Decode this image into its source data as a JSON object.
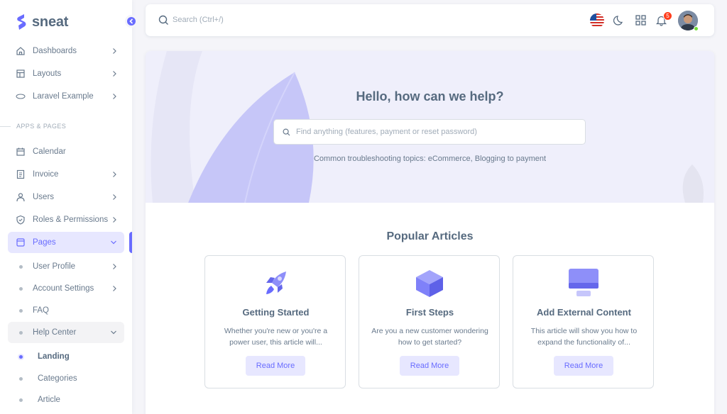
{
  "brand": {
    "name": "sneat"
  },
  "sidebar": {
    "items": [
      {
        "label": "Dashboards",
        "icon": "home-icon"
      },
      {
        "label": "Layouts",
        "icon": "layout-icon"
      },
      {
        "label": "Laravel Example",
        "icon": "php-icon"
      }
    ],
    "section_header": "APPS & PAGES",
    "app_items": [
      {
        "label": "Calendar",
        "icon": "calendar-icon"
      },
      {
        "label": "Invoice",
        "icon": "invoice-icon"
      },
      {
        "label": "Users",
        "icon": "user-icon"
      },
      {
        "label": "Roles & Permissions",
        "icon": "shield-icon"
      },
      {
        "label": "Pages",
        "icon": "page-icon"
      }
    ],
    "pages_sub": [
      {
        "label": "User Profile"
      },
      {
        "label": "Account Settings"
      },
      {
        "label": "FAQ"
      },
      {
        "label": "Help Center"
      }
    ],
    "help_sub": [
      {
        "label": "Landing"
      },
      {
        "label": "Categories"
      },
      {
        "label": "Article"
      }
    ]
  },
  "navbar": {
    "search_placeholder": "Search (Ctrl+/)",
    "notification_count": "5"
  },
  "hero": {
    "title": "Hello, how can we help?",
    "search_placeholder": "Find anything (features, payment or reset password)",
    "subtitle": "Common troubleshooting topics: eCommerce, Blogging to payment"
  },
  "articles_section": {
    "title": "Popular Articles",
    "items": [
      {
        "title": "Getting Started",
        "desc": "Whether you're new or you're a power user, this article will...",
        "button": "Read More",
        "icon": "rocket-icon"
      },
      {
        "title": "First Steps",
        "desc": "Are you a new customer wondering how to get started?",
        "button": "Read More",
        "icon": "cube-icon"
      },
      {
        "title": "Add External Content",
        "desc": "This article will show you how to expand the functionality of...",
        "button": "Read More",
        "icon": "monitor-icon"
      }
    ]
  },
  "colors": {
    "primary": "#696cff",
    "primary_light": "#e7e7ff",
    "danger": "#ff3e1d",
    "success": "#71dd37"
  }
}
